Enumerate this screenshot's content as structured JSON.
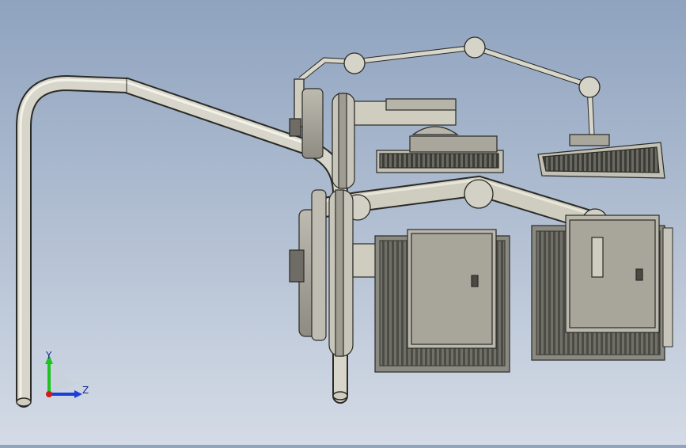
{
  "viewport": {
    "background_top": "#8fa3bf",
    "background_bottom": "#d4dbe6",
    "model_stroke": "#1e1e1e",
    "model_fill": "#cfcdbf",
    "model_fill_dark": "#9c9a8e"
  },
  "triad": {
    "y_label": "Y",
    "z_label": "Z",
    "y_axis_color": "#1fc21f",
    "z_axis_color": "#1b3fd6",
    "x_axis_color": "#d11a1a"
  }
}
